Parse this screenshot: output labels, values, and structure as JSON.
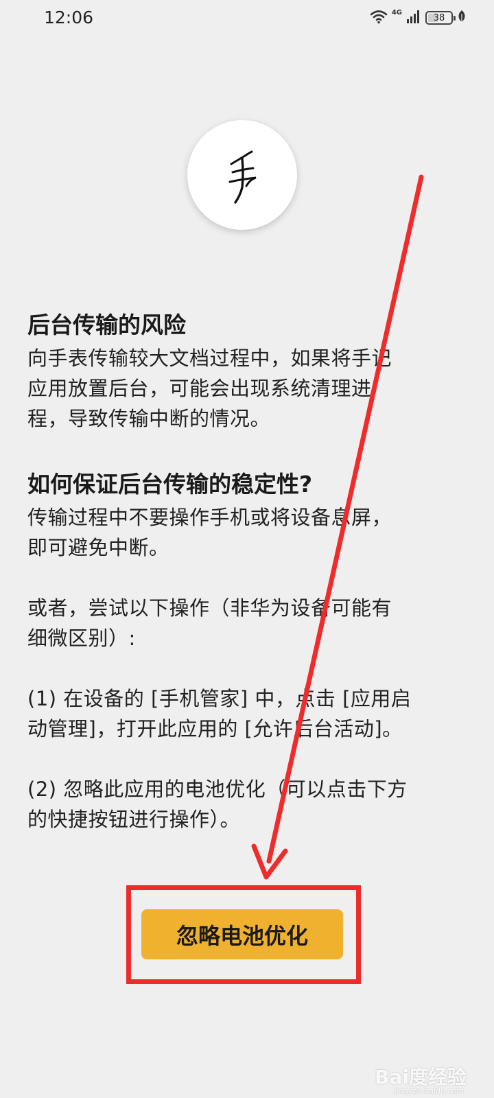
{
  "status_bar": {
    "time": "12:06",
    "network_label": "4G",
    "battery_level": "38"
  },
  "logo": {
    "icon": "handwriting-logo-icon"
  },
  "section1": {
    "heading": "后台传输的风险",
    "lines": [
      "向手表传输较大文档过程中，如果将手记",
      "应用放置后台，可能会出现系统清理进",
      "程，导致传输中断的情况。"
    ]
  },
  "section2": {
    "heading": "如何保证后台传输的稳定性?",
    "p1": [
      "传输过程中不要操作手机或将设备息屏，",
      "即可避免中断。"
    ],
    "p2": [
      "或者，尝试以下操作（非华为设备可能有",
      "细微区别）:"
    ],
    "p3": [
      "(1) 在设备的 [手机管家] 中，点击 [应用启",
      "动管理]，打开此应用的 [允许后台活动]。"
    ],
    "p4": [
      "(2) 忽略此应用的电池优化（可以点击下方",
      "的快捷按钮进行操作）。"
    ]
  },
  "button": {
    "label": "忽略电池优化"
  },
  "watermark": {
    "brand": "Bai度经验",
    "url": "jingyan.baidu.com"
  },
  "colors": {
    "background": "#efefef",
    "button": "#f0b22e",
    "annotation": "#ee2c2c"
  }
}
